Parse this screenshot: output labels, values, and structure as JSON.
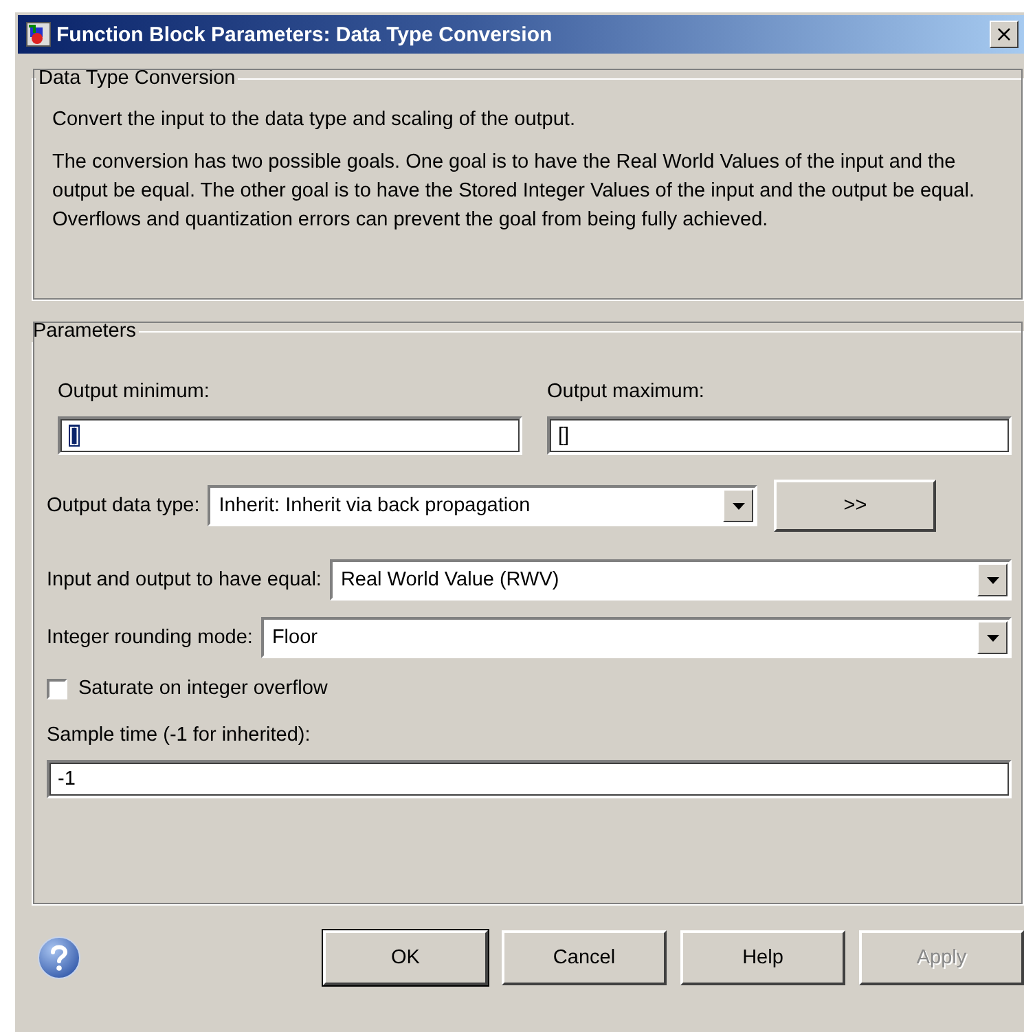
{
  "window": {
    "title": "Function Block Parameters: Data Type Conversion",
    "close": "×"
  },
  "description": {
    "title": "Data Type Conversion",
    "paragraphs": [
      "Convert the input to the data type and scaling of the output.",
      "The conversion has two possible goals. One goal is to have the Real World Values of the input and the output be equal.  The other goal is to have the Stored Integer Values of the input and the output be equal.  Overflows and quantization errors can prevent the goal from being fully achieved."
    ]
  },
  "parameters": {
    "title": "Parameters",
    "output_minimum": {
      "label": "Output minimum:",
      "value": "[]",
      "selected": true
    },
    "output_maximum": {
      "label": "Output maximum:",
      "value": "[]",
      "selected": false
    },
    "output_data_type": {
      "label": "Output data type:",
      "value": "Inherit: Inherit via back propagation",
      "button": ">>"
    },
    "equal": {
      "label": "Input and output to have equal:",
      "value": "Real World Value (RWV)"
    },
    "rounding": {
      "label": "Integer rounding mode:",
      "value": "Floor"
    },
    "saturate": {
      "label": "Saturate on integer overflow",
      "checked": false
    },
    "sample_time": {
      "label": "Sample time (-1 for inherited):",
      "value": "-1"
    }
  },
  "buttons": [
    {
      "label": "OK",
      "disabled": false,
      "default": true
    },
    {
      "label": "Cancel",
      "disabled": false,
      "default": false
    },
    {
      "label": "Help",
      "disabled": false,
      "default": false
    },
    {
      "label": "Apply",
      "disabled": true,
      "default": false
    }
  ]
}
